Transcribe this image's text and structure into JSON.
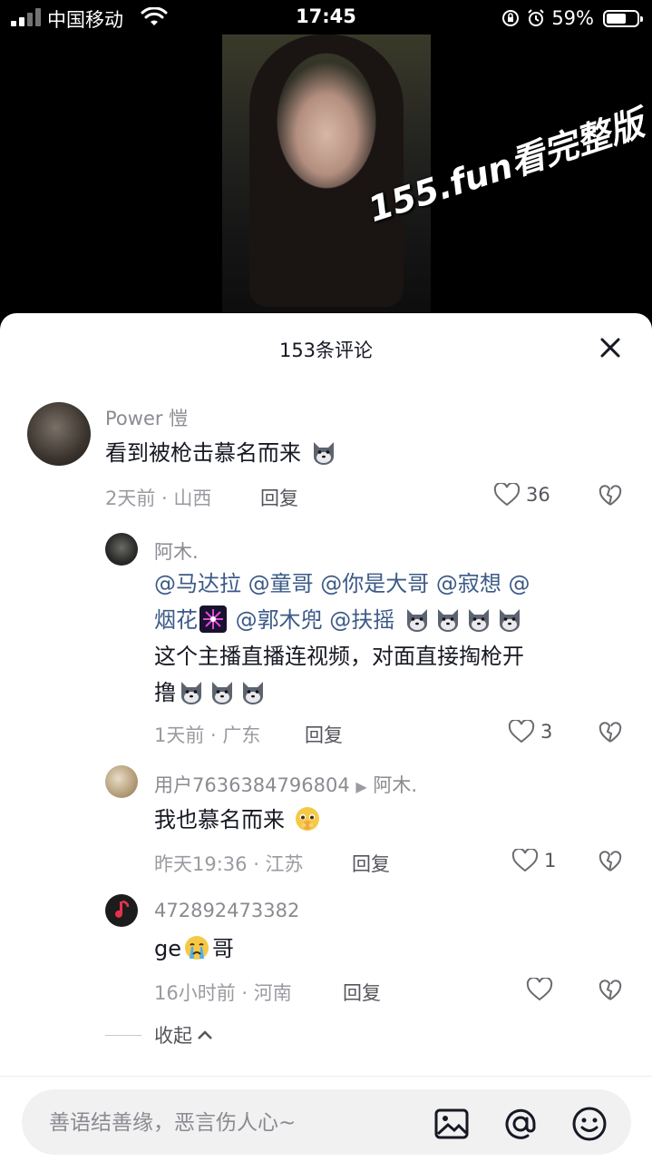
{
  "status_bar": {
    "carrier": "中国移动",
    "time": "17:45",
    "battery": "59%",
    "battery_level": 0.59
  },
  "video": {
    "watermark": "155.fun看完整版"
  },
  "comments_sheet": {
    "title": "153条评论",
    "close_icon": "close-icon",
    "comments": [
      {
        "user": "Power 愷",
        "text": "看到被枪击慕名而来",
        "emoji": "wolf-emoji",
        "meta": "2天前 · 山西",
        "reply_label": "回复",
        "likes": "36"
      }
    ],
    "replies": [
      {
        "user": "阿木.",
        "mentions_line1": "@马达拉 @童哥 @你是大哥 @寂想 @",
        "mentions_line2_a": "烟花",
        "mentions_line2_b": "@郭木兜 @扶摇",
        "text_line3": "这个主播直播连视频，对面直接掏枪开",
        "text_line4": "撸",
        "meta": "1天前 · 广东",
        "reply_label": "回复",
        "likes": "3"
      },
      {
        "user": "用户7636384796804",
        "reply_to": "阿木.",
        "text": "我也慕名而来",
        "meta": "昨天19:36 · 江苏",
        "reply_label": "回复",
        "likes": "1"
      },
      {
        "user": "472892473382",
        "text_a": "ge",
        "text_b": "哥",
        "meta": "16小时前 · 河南",
        "reply_label": "回复",
        "likes": ""
      }
    ],
    "collapse_label": "收起"
  },
  "input_bar": {
    "placeholder": "善语结善缘，恶言伤人心~",
    "icons": [
      "image-icon",
      "at-icon",
      "emoji-icon"
    ]
  },
  "colors": {
    "mention": "#3c5a87",
    "meta_gray": "#9a9ba1",
    "sheet_bg": "#ffffff"
  }
}
